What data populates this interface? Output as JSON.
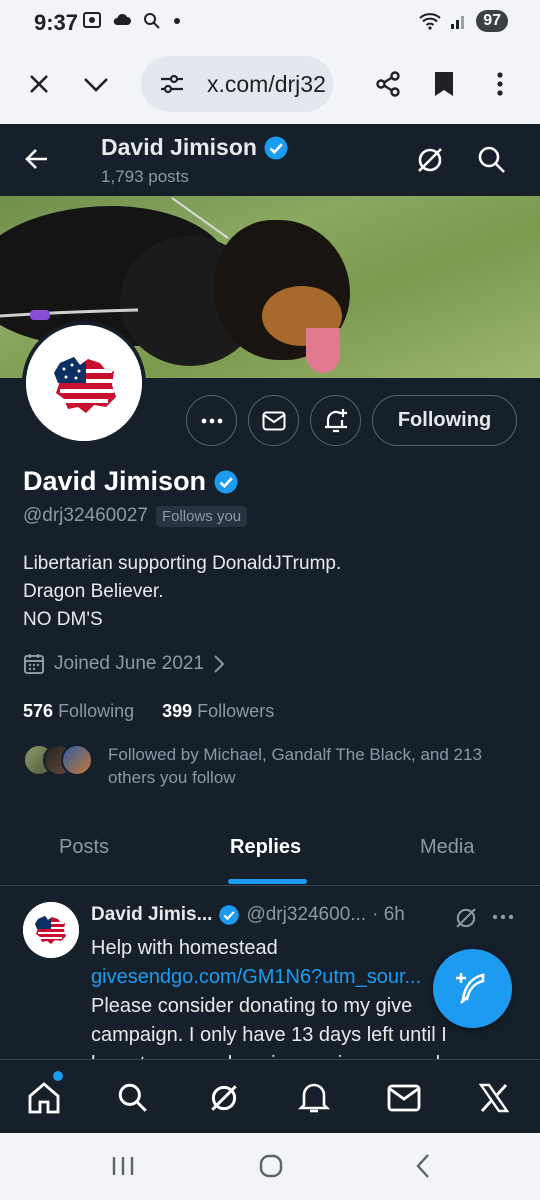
{
  "status_bar": {
    "time": "9:37",
    "battery": "97"
  },
  "browser": {
    "url": "x.com/drj32"
  },
  "profile_header": {
    "name": "David Jimison",
    "posts": "1,793 posts"
  },
  "profile": {
    "name": "David Jimison",
    "handle": "@drj32460027",
    "follows_you": "Follows you",
    "bio_lines": [
      "Libertarian supporting DonaldJTrump.",
      "Dragon Believer.",
      "NO DM'S"
    ],
    "joined": "Joined June 2021",
    "following_count": "576",
    "following_label": "Following",
    "followers_count": "399",
    "followers_label": "Followers",
    "followed_by": "Followed by Michael, Gandalf The Black, and 213 others you follow",
    "follow_button": "Following"
  },
  "tabs": [
    "Posts",
    "Replies",
    "Media"
  ],
  "active_tab": "Replies",
  "tweet": {
    "name": "David Jimis...",
    "handle": "@drj324600...",
    "time": "· 6h",
    "line1": "Help with homestead",
    "link": "givesendgo.com/GM1N6?utm_sour...",
    "line2": "Please consider donating to my give",
    "line3": "campaign. I only have 13 days left until I",
    "line4": "have to secure housing or give up my dogs"
  },
  "colors": {
    "background": "#15202b",
    "accent": "#1d9bf0",
    "muted": "#8b98a5"
  }
}
